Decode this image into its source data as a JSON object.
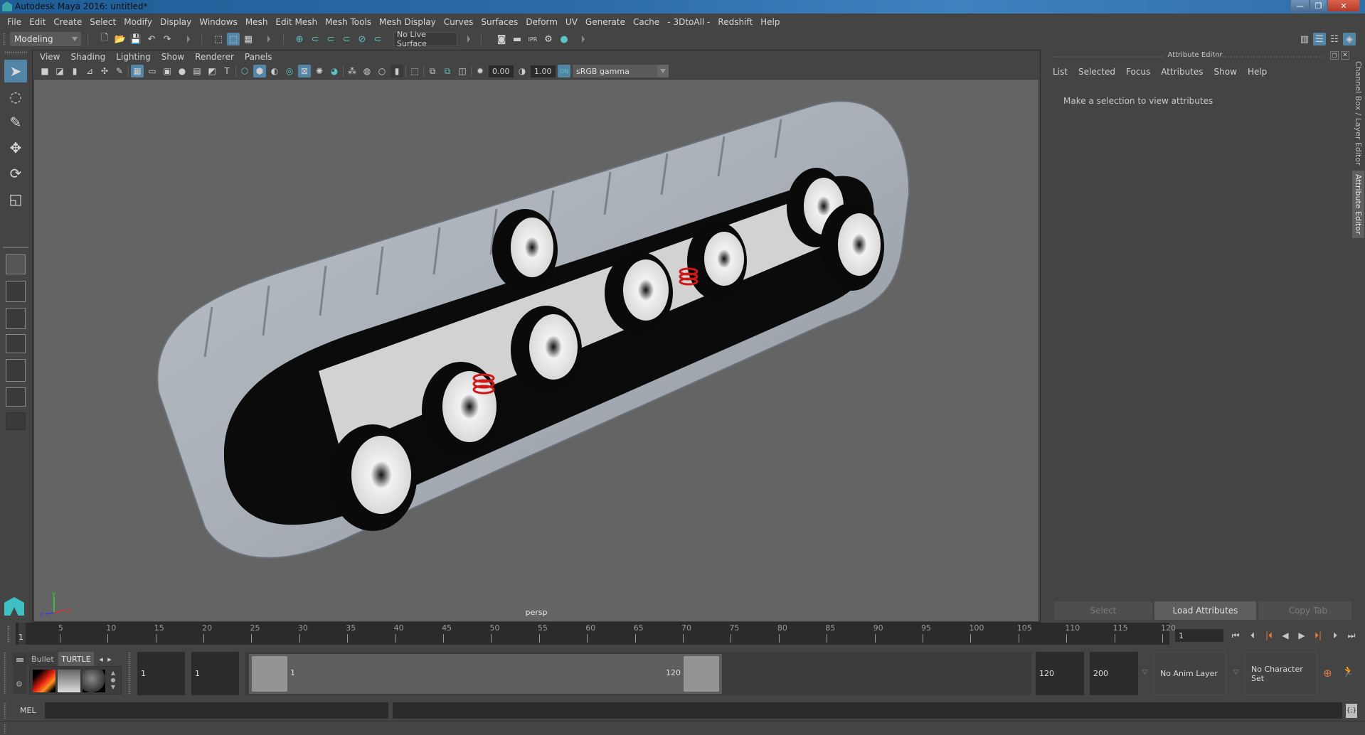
{
  "window": {
    "title": "Autodesk Maya 2016: untitled*",
    "controls": {
      "minimize": "—",
      "maximize": "❐",
      "close": "✕"
    }
  },
  "menubar": [
    "File",
    "Edit",
    "Create",
    "Select",
    "Modify",
    "Display",
    "Windows",
    "Mesh",
    "Edit Mesh",
    "Mesh Tools",
    "Mesh Display",
    "Curves",
    "Surfaces",
    "Deform",
    "UV",
    "Generate",
    "Cache",
    "- 3DtoAll -",
    "Redshift",
    "Help"
  ],
  "statusline": {
    "mode": "Modeling",
    "live_surface": "No Live Surface",
    "icons": [
      "new-scene",
      "open-scene",
      "save-scene",
      "undo",
      "redo",
      "select-by-hierarchy",
      "select-by-object",
      "select-by-component",
      "snap-to-grid",
      "snap-to-curve",
      "snap-to-point",
      "snap-to-projected-center",
      "snap-to-view-plane",
      "make-live",
      "render-view",
      "render-current-frame",
      "ipr-render",
      "render-settings",
      "hypershade"
    ]
  },
  "toolbox": {
    "tools": [
      "select-tool",
      "lasso-tool",
      "paint-select-tool",
      "move-tool",
      "rotate-tool",
      "scale-tool"
    ],
    "layouts": [
      "single-perspective",
      "four-view",
      "persp-outliner",
      "persp-graph",
      "hypershade-persp",
      "persp-graph-hypershade",
      "more-layouts"
    ]
  },
  "viewport": {
    "menu": [
      "View",
      "Shading",
      "Lighting",
      "Show",
      "Renderer",
      "Panels"
    ],
    "exposure": "0.00",
    "gamma": "1.00",
    "colorspace": "sRGB gamma",
    "camera": "persp",
    "axis_labels": {
      "x": "x",
      "y": "y",
      "z": "z"
    }
  },
  "attribute_editor": {
    "title": "Attribute Editor",
    "menu": [
      "List",
      "Selected",
      "Focus",
      "Attributes",
      "Show",
      "Help"
    ],
    "message": "Make a selection to view attributes",
    "buttons": {
      "select": "Select",
      "load": "Load Attributes",
      "copy": "Copy Tab"
    },
    "side_tabs": [
      "Channel Box / Layer Editor",
      "Attribute Editor"
    ],
    "active_side_tab": "Attribute Editor"
  },
  "timeline": {
    "start_label": "1",
    "ticks": [
      5,
      10,
      15,
      20,
      25,
      30,
      35,
      40,
      45,
      50,
      55,
      60,
      65,
      70,
      75,
      80,
      85,
      90,
      95,
      100,
      105,
      110,
      115,
      120
    ],
    "current_frame": "1",
    "playback": [
      "go-to-start",
      "step-back-frame",
      "step-back-key",
      "play-backwards",
      "play-forwards",
      "step-forward-key",
      "step-forward-frame",
      "go-to-end"
    ]
  },
  "range": {
    "shelf_tabs": [
      "Bullet",
      "TURTLE"
    ],
    "active_shelf": "TURTLE",
    "start_time": "1",
    "playback_start": "1",
    "slider_start": "1",
    "slider_end": "120",
    "playback_end": "120",
    "end_time": "200",
    "anim_layer": "No Anim Layer",
    "character_set": "No Character Set"
  },
  "command_line": {
    "language": "MEL",
    "input": "",
    "output": ""
  },
  "colors": {
    "accent": "#5285a6",
    "teal": "#5cc2c2",
    "viewport_bg": "#646464",
    "panel_bg": "#444444"
  }
}
